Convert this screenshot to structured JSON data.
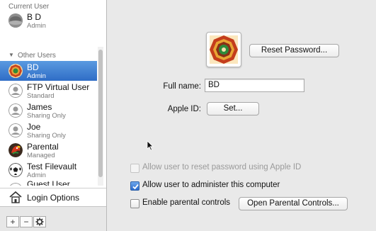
{
  "sidebar": {
    "current_user_title": "Current User",
    "current_user": {
      "name": "B D",
      "role": "Admin"
    },
    "other_users_title": "Other Users",
    "users": [
      {
        "name": "BD",
        "role": "Admin",
        "icon": "bagua-avatar-icon",
        "selected": true
      },
      {
        "name": "FTP Virtual User",
        "role": "Standard",
        "icon": "generic-user-icon"
      },
      {
        "name": "James",
        "role": "Sharing Only",
        "icon": "generic-user-icon"
      },
      {
        "name": "Joe",
        "role": "Sharing Only",
        "icon": "generic-user-icon"
      },
      {
        "name": "Parental",
        "role": "Managed",
        "icon": "parrot-avatar-icon"
      },
      {
        "name": "Test Filevault",
        "role": "Admin",
        "icon": "soccer-ball-icon"
      },
      {
        "name": "Guest User",
        "role": "",
        "icon": "generic-user-icon"
      }
    ],
    "login_options_label": "Login Options",
    "add_symbol": "+",
    "remove_symbol": "−",
    "gear_icon": "gear-icon"
  },
  "main": {
    "reset_password_label": "Reset Password...",
    "full_name_label": "Full name:",
    "full_name_value": "BD",
    "apple_id_label": "Apple ID:",
    "set_button_label": "Set...",
    "options": [
      {
        "label": "Allow user to reset password using Apple ID",
        "checked": false,
        "disabled": true
      },
      {
        "label": "Allow user to administer this computer",
        "checked": true,
        "disabled": false
      },
      {
        "label": "Enable parental controls",
        "checked": false,
        "disabled": false
      }
    ],
    "open_parental_controls_label": "Open Parental Controls..."
  },
  "colors": {
    "selection": "#3a7bd5",
    "accent_checkbox": "#2c6bcc",
    "pane_background": "#e9e9e9"
  }
}
